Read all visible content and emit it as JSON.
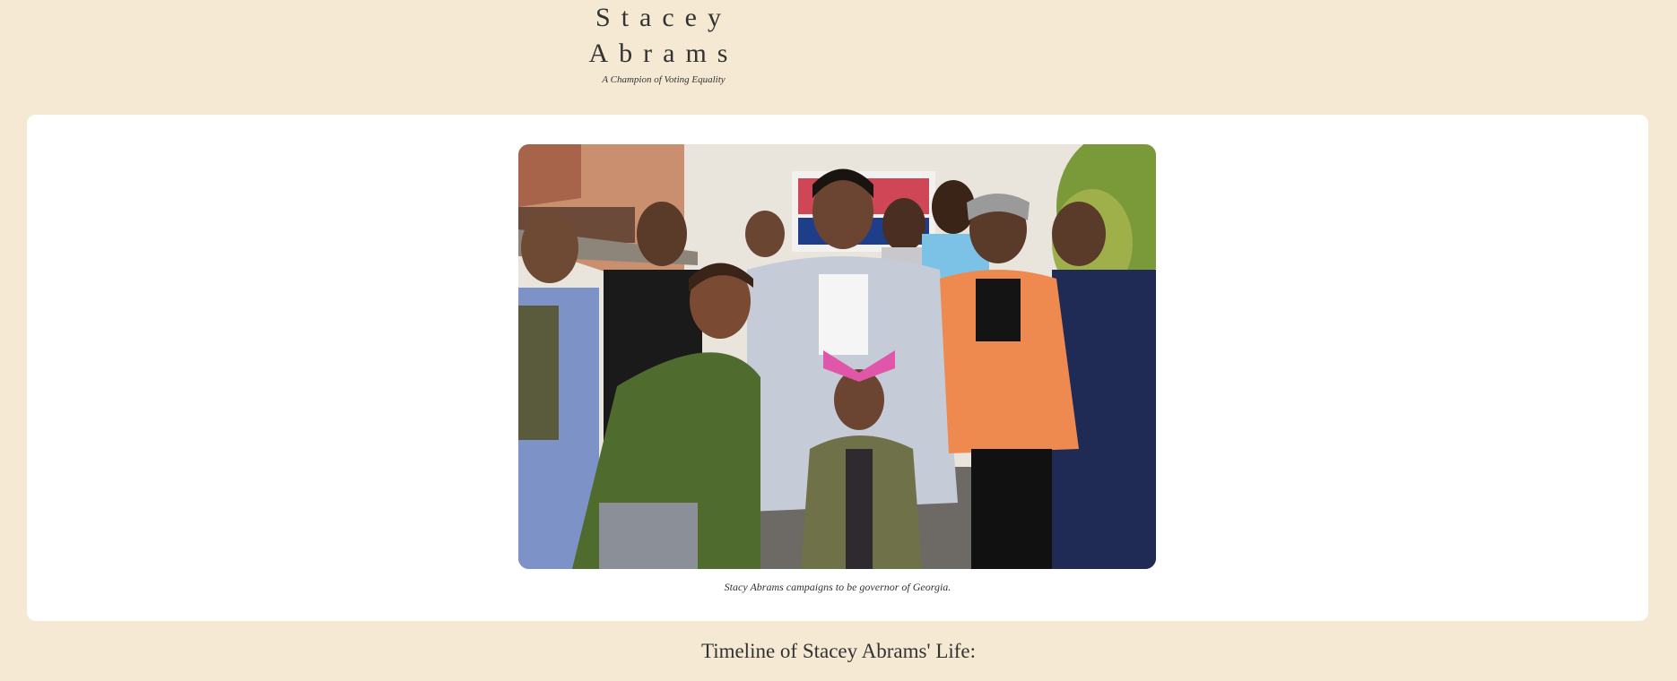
{
  "header": {
    "title": "Stacey Abrams",
    "subtitle": "A Champion of Voting Equality"
  },
  "feature": {
    "image_alt": "Stacey Abrams with a group of supporters at a campaign event",
    "caption": "Stacy Abrams campaigns to be governor of Georgia."
  },
  "timeline": {
    "heading": "Timeline of Stacey Abrams' Life:"
  },
  "colors": {
    "page_background": "#f5e9d3",
    "card_background": "#ffffff",
    "text": "#333333"
  }
}
